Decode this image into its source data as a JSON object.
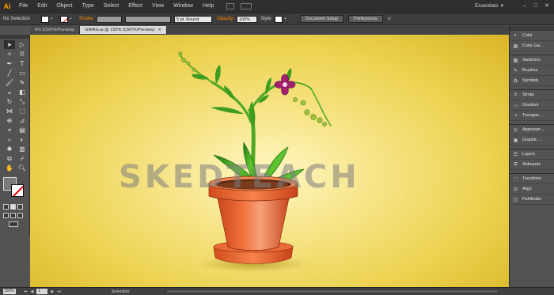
{
  "app": {
    "logo": "Ai"
  },
  "menu": {
    "items": [
      "File",
      "Edit",
      "Object",
      "Type",
      "Select",
      "Effect",
      "View",
      "Window",
      "Help"
    ],
    "workspace": "Essentials",
    "window_controls": [
      "–",
      "□",
      "✕"
    ]
  },
  "control_bar": {
    "selection_label": "No Selection",
    "stroke_label": "Stroke:",
    "brush_value": "5 pt. Round",
    "opacity_label": "Opacity:",
    "opacity_value": "100%",
    "style_label": "Style:",
    "document_setup": "Document Setup",
    "preferences": "Preferences"
  },
  "tabs": [
    {
      "label": "0% (CMYK/Preview)",
      "active": false
    },
    {
      "label": "GWRG.ai @ 150% (CMYK/Preview)",
      "active": true
    }
  ],
  "canvas": {
    "watermark": "SKEDTEACH",
    "background_color": "#ecd24f"
  },
  "tools": [
    "selection-tool",
    "direct-selection-tool",
    "magic-wand-tool",
    "lasso-tool",
    "pen-tool",
    "type-tool",
    "line-tool",
    "rectangle-tool",
    "paintbrush-tool",
    "pencil-tool",
    "blob-brush-tool",
    "eraser-tool",
    "rotate-tool",
    "scale-tool",
    "width-tool",
    "free-transform-tool",
    "shape-builder-tool",
    "perspective-grid-tool",
    "mesh-tool",
    "gradient-tool",
    "eyedropper-tool",
    "blend-tool",
    "symbol-sprayer-tool",
    "column-graph-tool",
    "artboard-tool",
    "slice-tool",
    "hand-tool",
    "zoom-tool"
  ],
  "panels": {
    "items": [
      {
        "label": "Color",
        "icon": "color-icon"
      },
      {
        "label": "Color Gui...",
        "icon": "color-guide-icon"
      },
      {
        "label": "Swatches",
        "icon": "swatches-icon"
      },
      {
        "label": "Brushes",
        "icon": "brushes-icon"
      },
      {
        "label": "Symbols",
        "icon": "symbols-icon"
      },
      {
        "label": "Stroke",
        "icon": "stroke-icon"
      },
      {
        "label": "Gradient",
        "icon": "gradient-icon"
      },
      {
        "label": "Transpar...",
        "icon": "transparency-icon"
      },
      {
        "label": "Appearan...",
        "icon": "appearance-icon"
      },
      {
        "label": "Graphic ...",
        "icon": "graphic-styles-icon"
      },
      {
        "label": "Layers",
        "icon": "layers-icon"
      },
      {
        "label": "Artboards",
        "icon": "artboards-icon"
      },
      {
        "label": "Transform",
        "icon": "transform-icon"
      },
      {
        "label": "Align",
        "icon": "align-icon"
      },
      {
        "label": "Pathfinder",
        "icon": "pathfinder-icon"
      }
    ]
  },
  "status": {
    "zoom": "150%",
    "artboard": "1",
    "tool": "Selection"
  }
}
